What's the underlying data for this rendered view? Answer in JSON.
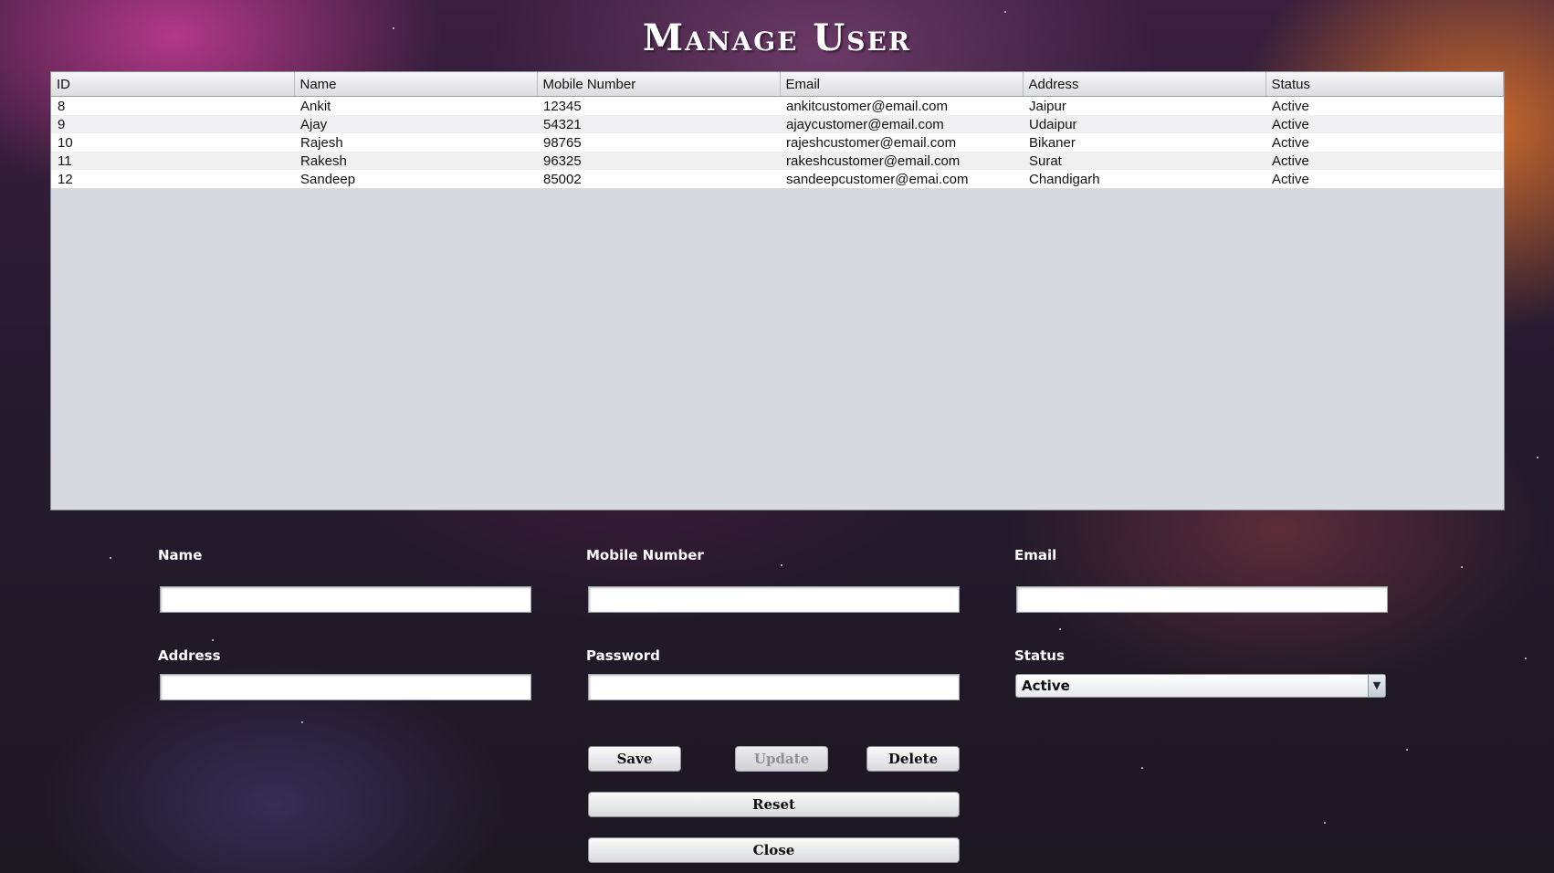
{
  "title": "Manage User",
  "table": {
    "columns": [
      "ID",
      "Name",
      "Mobile Number",
      "Email",
      "Address",
      "Status"
    ],
    "rows": [
      [
        "8",
        "Ankit",
        "12345",
        "ankitcustomer@email.com",
        "Jaipur",
        "Active"
      ],
      [
        "9",
        "Ajay",
        "54321",
        "ajaycustomer@email.com",
        "Udaipur",
        "Active"
      ],
      [
        "10",
        "Rajesh",
        "98765",
        "rajeshcustomer@email.com",
        "Bikaner",
        "Active"
      ],
      [
        "11",
        "Rakesh",
        "96325",
        "rakeshcustomer@email.com",
        "Surat",
        "Active"
      ],
      [
        "12",
        "Sandeep",
        "85002",
        "sandeepcustomer@emai.com",
        "Chandigarh",
        "Active"
      ]
    ]
  },
  "form": {
    "name_label": "Name",
    "mobile_label": "Mobile Number",
    "email_label": "Email",
    "address_label": "Address",
    "password_label": "Password",
    "status_label": "Status",
    "status_value": "Active",
    "name_value": "",
    "mobile_value": "",
    "email_value": "",
    "address_value": "",
    "password_value": ""
  },
  "buttons": {
    "save": "Save",
    "update": "Update",
    "delete": "Delete",
    "reset": "Reset",
    "close": "Close"
  },
  "colors": {
    "header_bg": "#e4e5e8",
    "table_bg": "#d6d9e0",
    "label_text": "#ffffff"
  }
}
